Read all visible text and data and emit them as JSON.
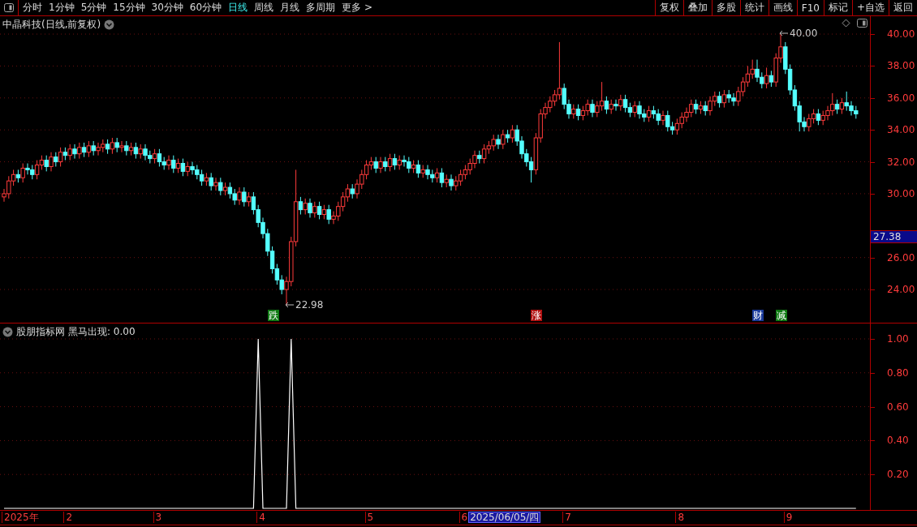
{
  "toolbar": {
    "periods": [
      {
        "label": "分时",
        "selected": false
      },
      {
        "label": "1分钟",
        "selected": false
      },
      {
        "label": "5分钟",
        "selected": false
      },
      {
        "label": "15分钟",
        "selected": false
      },
      {
        "label": "30分钟",
        "selected": false
      },
      {
        "label": "60分钟",
        "selected": false
      },
      {
        "label": "日线",
        "selected": true
      },
      {
        "label": "周线",
        "selected": false
      },
      {
        "label": "月线",
        "selected": false
      },
      {
        "label": "多周期",
        "selected": false
      },
      {
        "label": "更多 >",
        "selected": false
      }
    ],
    "buttons": [
      "复权",
      "叠加",
      "多股",
      "统计",
      "画线",
      "F10",
      "标记",
      "+自选",
      "返回"
    ]
  },
  "main_chart": {
    "title": "中晶科技(日线,前复权)",
    "current_price": "27.38",
    "price_marks": [
      "40.00",
      "22.98"
    ],
    "chart_data": {
      "type": "candlestick",
      "grid": true,
      "ylim": [
        21.92,
        41.12
      ],
      "yticks": [
        {
          "value": 40,
          "label": "40.00"
        },
        {
          "value": 38,
          "label": "38.00"
        },
        {
          "value": 36,
          "label": "36.00"
        },
        {
          "value": 34,
          "label": "34.00"
        },
        {
          "value": 32,
          "label": "32.00"
        },
        {
          "value": 30,
          "label": "30.00"
        },
        {
          "value": 26,
          "label": "26.00"
        },
        {
          "value": 24,
          "label": "24.00"
        }
      ],
      "ohlc": [
        [
          29.8,
          30.3,
          29.5,
          30.0
        ],
        [
          30.0,
          31.1,
          29.7,
          30.8
        ],
        [
          30.8,
          31.5,
          30.5,
          31.2
        ],
        [
          31.2,
          31.5,
          30.7,
          31.0
        ],
        [
          31.0,
          31.9,
          30.7,
          31.6
        ],
        [
          31.6,
          31.9,
          31.2,
          31.5
        ],
        [
          31.5,
          31.8,
          30.9,
          31.2
        ],
        [
          31.2,
          32.1,
          30.9,
          31.8
        ],
        [
          31.8,
          32.4,
          31.5,
          32.1
        ],
        [
          32.1,
          32.4,
          31.4,
          31.7
        ],
        [
          31.7,
          32.6,
          31.4,
          32.3
        ],
        [
          32.3,
          32.6,
          31.7,
          32.0
        ],
        [
          32.0,
          32.9,
          31.7,
          32.6
        ],
        [
          32.6,
          32.9,
          32.1,
          32.4
        ],
        [
          32.4,
          33.1,
          32.1,
          32.8
        ],
        [
          32.8,
          33.1,
          32.2,
          32.5
        ],
        [
          32.5,
          33.2,
          32.2,
          32.9
        ],
        [
          32.9,
          33.2,
          32.3,
          32.6
        ],
        [
          32.6,
          33.3,
          32.3,
          33.0
        ],
        [
          33.0,
          33.3,
          32.4,
          32.7
        ],
        [
          32.7,
          33.2,
          32.4,
          32.9
        ],
        [
          32.9,
          33.4,
          32.6,
          33.1
        ],
        [
          33.1,
          33.4,
          32.5,
          32.8
        ],
        [
          32.8,
          33.5,
          32.5,
          33.2
        ],
        [
          33.2,
          33.5,
          32.6,
          32.9
        ],
        [
          32.9,
          33.3,
          32.6,
          33.0
        ],
        [
          33.0,
          33.3,
          32.4,
          32.7
        ],
        [
          32.7,
          33.2,
          32.4,
          32.9
        ],
        [
          32.9,
          33.2,
          32.2,
          32.5
        ],
        [
          32.5,
          33.1,
          32.2,
          32.8
        ],
        [
          32.8,
          33.1,
          32.1,
          32.4
        ],
        [
          32.4,
          32.7,
          31.9,
          32.2
        ],
        [
          32.2,
          32.8,
          31.9,
          32.5
        ],
        [
          32.5,
          32.8,
          31.7,
          32.0
        ],
        [
          32.0,
          32.3,
          31.5,
          31.8
        ],
        [
          31.8,
          32.4,
          31.5,
          32.1
        ],
        [
          32.1,
          32.4,
          31.3,
          31.6
        ],
        [
          31.6,
          32.2,
          31.3,
          31.9
        ],
        [
          31.9,
          32.2,
          31.1,
          31.4
        ],
        [
          31.4,
          32.0,
          31.1,
          31.7
        ],
        [
          31.7,
          32.0,
          31.2,
          31.5
        ],
        [
          31.5,
          31.8,
          30.9,
          31.2
        ],
        [
          31.2,
          31.5,
          30.5,
          30.8
        ],
        [
          30.8,
          31.3,
          30.5,
          31.0
        ],
        [
          31.0,
          31.3,
          30.2,
          30.5
        ],
        [
          30.5,
          31.0,
          30.2,
          30.7
        ],
        [
          30.7,
          31.0,
          29.9,
          30.2
        ],
        [
          30.2,
          30.7,
          29.9,
          30.4
        ],
        [
          30.4,
          30.7,
          29.7,
          30.0
        ],
        [
          30.0,
          30.3,
          29.3,
          29.6
        ],
        [
          29.6,
          30.4,
          29.3,
          30.1
        ],
        [
          30.1,
          30.4,
          29.2,
          29.5
        ],
        [
          29.5,
          30.1,
          29.2,
          29.8
        ],
        [
          29.8,
          30.1,
          28.7,
          29.0
        ],
        [
          29.0,
          29.3,
          27.9,
          28.2
        ],
        [
          28.2,
          28.5,
          27.2,
          27.5
        ],
        [
          27.5,
          27.8,
          26.1,
          26.4
        ],
        [
          26.4,
          26.7,
          25.0,
          25.3
        ],
        [
          25.3,
          25.6,
          24.3,
          24.6
        ],
        [
          24.6,
          24.9,
          23.7,
          24.0
        ],
        [
          24.0,
          24.8,
          22.98,
          24.5
        ],
        [
          24.5,
          27.3,
          24.2,
          27.0
        ],
        [
          27.0,
          31.5,
          26.7,
          29.5
        ],
        [
          29.5,
          29.8,
          28.7,
          29.0
        ],
        [
          29.0,
          29.7,
          28.7,
          29.4
        ],
        [
          29.4,
          29.7,
          28.5,
          28.8
        ],
        [
          28.8,
          29.5,
          28.5,
          29.2
        ],
        [
          29.2,
          29.5,
          28.4,
          28.7
        ],
        [
          28.7,
          29.3,
          28.4,
          29.0
        ],
        [
          29.0,
          29.3,
          28.1,
          28.4
        ],
        [
          28.4,
          28.9,
          28.1,
          28.6
        ],
        [
          28.6,
          29.5,
          28.3,
          29.2
        ],
        [
          29.2,
          30.1,
          28.9,
          29.8
        ],
        [
          29.8,
          30.6,
          29.5,
          30.3
        ],
        [
          30.3,
          30.6,
          29.7,
          30.0
        ],
        [
          30.0,
          30.9,
          29.7,
          30.6
        ],
        [
          30.6,
          31.5,
          30.3,
          31.2
        ],
        [
          31.2,
          32.1,
          30.9,
          31.8
        ],
        [
          31.8,
          32.3,
          31.5,
          32.0
        ],
        [
          32.0,
          32.3,
          31.3,
          31.6
        ],
        [
          31.6,
          32.3,
          31.3,
          32.0
        ],
        [
          32.0,
          32.3,
          31.4,
          31.7
        ],
        [
          31.7,
          32.5,
          31.4,
          32.2
        ],
        [
          32.2,
          32.5,
          31.5,
          31.8
        ],
        [
          31.8,
          32.4,
          31.5,
          32.1
        ],
        [
          32.1,
          32.4,
          31.7,
          32.0
        ],
        [
          32.0,
          32.3,
          31.3,
          31.6
        ],
        [
          31.6,
          32.1,
          31.3,
          31.8
        ],
        [
          31.8,
          32.1,
          31.0,
          31.3
        ],
        [
          31.3,
          31.8,
          31.0,
          31.5
        ],
        [
          31.5,
          31.8,
          30.9,
          31.2
        ],
        [
          31.2,
          31.5,
          30.7,
          31.0
        ],
        [
          31.0,
          31.6,
          30.7,
          31.3
        ],
        [
          31.3,
          31.6,
          30.4,
          30.7
        ],
        [
          30.7,
          31.2,
          30.4,
          30.9
        ],
        [
          30.9,
          31.2,
          30.2,
          30.5
        ],
        [
          30.5,
          31.1,
          30.2,
          30.8
        ],
        [
          30.8,
          31.5,
          30.5,
          31.2
        ],
        [
          31.2,
          31.8,
          30.9,
          31.5
        ],
        [
          31.5,
          32.2,
          31.2,
          31.9
        ],
        [
          31.9,
          32.7,
          31.6,
          32.4
        ],
        [
          32.4,
          32.7,
          31.9,
          32.2
        ],
        [
          32.2,
          33.1,
          31.9,
          32.8
        ],
        [
          32.8,
          33.3,
          32.5,
          33.0
        ],
        [
          33.0,
          33.7,
          32.7,
          33.4
        ],
        [
          33.4,
          33.7,
          32.8,
          33.1
        ],
        [
          33.1,
          34.0,
          32.8,
          33.7
        ],
        [
          33.7,
          34.0,
          33.2,
          33.5
        ],
        [
          33.5,
          34.3,
          33.2,
          34.0
        ],
        [
          34.0,
          34.3,
          33.0,
          33.3
        ],
        [
          33.3,
          33.6,
          32.2,
          32.5
        ],
        [
          32.5,
          32.8,
          31.7,
          32.0
        ],
        [
          32.0,
          32.3,
          30.7,
          31.5
        ],
        [
          31.5,
          33.8,
          31.2,
          33.5
        ],
        [
          33.5,
          35.3,
          33.2,
          35.0
        ],
        [
          35.0,
          35.7,
          34.7,
          35.4
        ],
        [
          35.4,
          36.1,
          35.1,
          35.8
        ],
        [
          35.8,
          36.5,
          35.5,
          36.2
        ],
        [
          36.2,
          39.5,
          35.9,
          36.6
        ],
        [
          36.6,
          36.9,
          35.3,
          35.6
        ],
        [
          35.6,
          35.9,
          34.7,
          35.0
        ],
        [
          35.0,
          35.6,
          34.7,
          35.3
        ],
        [
          35.3,
          35.6,
          34.6,
          34.9
        ],
        [
          34.9,
          35.5,
          34.6,
          35.2
        ],
        [
          35.2,
          35.9,
          34.9,
          35.6
        ],
        [
          35.6,
          35.9,
          34.8,
          35.1
        ],
        [
          35.1,
          35.8,
          34.8,
          35.5
        ],
        [
          35.5,
          37.0,
          35.2,
          35.8
        ],
        [
          35.8,
          36.1,
          35.0,
          35.3
        ],
        [
          35.3,
          35.9,
          35.0,
          35.6
        ],
        [
          35.6,
          35.9,
          35.2,
          35.5
        ],
        [
          35.5,
          36.2,
          35.2,
          35.9
        ],
        [
          35.9,
          36.2,
          35.1,
          35.4
        ],
        [
          35.4,
          35.7,
          34.8,
          35.1
        ],
        [
          35.1,
          35.8,
          34.8,
          35.5
        ],
        [
          35.5,
          35.8,
          34.7,
          35.0
        ],
        [
          35.0,
          35.3,
          34.5,
          34.8
        ],
        [
          34.8,
          35.5,
          34.5,
          35.2
        ],
        [
          35.2,
          35.5,
          34.7,
          35.0
        ],
        [
          35.0,
          35.3,
          34.3,
          34.6
        ],
        [
          34.6,
          35.2,
          34.3,
          34.9
        ],
        [
          34.9,
          35.2,
          33.9,
          34.2
        ],
        [
          34.2,
          34.5,
          33.7,
          34.0
        ],
        [
          34.0,
          34.7,
          33.7,
          34.4
        ],
        [
          34.4,
          35.1,
          34.1,
          34.8
        ],
        [
          34.8,
          35.4,
          34.5,
          35.1
        ],
        [
          35.1,
          35.9,
          34.8,
          35.6
        ],
        [
          35.6,
          35.9,
          35.0,
          35.3
        ],
        [
          35.3,
          35.8,
          35.0,
          35.5
        ],
        [
          35.5,
          35.8,
          34.9,
          35.2
        ],
        [
          35.2,
          36.1,
          34.9,
          35.8
        ],
        [
          35.8,
          36.4,
          35.5,
          36.1
        ],
        [
          36.1,
          36.4,
          35.4,
          35.7
        ],
        [
          35.7,
          36.5,
          35.4,
          36.2
        ],
        [
          36.2,
          36.5,
          35.7,
          36.0
        ],
        [
          36.0,
          36.3,
          35.5,
          35.8
        ],
        [
          35.8,
          36.7,
          35.5,
          36.4
        ],
        [
          36.4,
          37.3,
          36.1,
          37.0
        ],
        [
          37.0,
          38.0,
          36.7,
          37.5
        ],
        [
          37.5,
          38.4,
          37.2,
          37.8
        ],
        [
          37.8,
          38.4,
          37.0,
          37.3
        ],
        [
          37.3,
          37.6,
          36.6,
          36.9
        ],
        [
          36.9,
          37.9,
          36.6,
          37.4
        ],
        [
          37.4,
          37.7,
          36.7,
          37.0
        ],
        [
          37.0,
          38.8,
          36.7,
          38.5
        ],
        [
          38.5,
          40.0,
          38.2,
          39.2
        ],
        [
          39.2,
          39.5,
          37.5,
          37.8
        ],
        [
          37.8,
          38.1,
          36.2,
          36.5
        ],
        [
          36.5,
          36.8,
          35.2,
          35.5
        ],
        [
          35.5,
          35.8,
          33.9,
          34.5
        ],
        [
          34.5,
          34.8,
          33.9,
          34.2
        ],
        [
          34.2,
          35.0,
          33.9,
          34.7
        ],
        [
          34.7,
          35.3,
          34.4,
          35.0
        ],
        [
          35.0,
          35.3,
          34.3,
          34.6
        ],
        [
          34.6,
          35.2,
          34.3,
          34.9
        ],
        [
          34.9,
          35.5,
          34.6,
          35.2
        ],
        [
          35.2,
          36.3,
          34.9,
          35.6
        ],
        [
          35.6,
          35.9,
          35.0,
          35.3
        ],
        [
          35.3,
          36.0,
          35.0,
          35.7
        ],
        [
          35.7,
          36.4,
          35.2,
          35.5
        ],
        [
          35.5,
          35.8,
          34.9,
          35.2
        ],
        [
          35.2,
          35.5,
          34.7,
          35.0
        ]
      ]
    },
    "events": [
      {
        "label": "跌",
        "color": "#0e7a12"
      },
      {
        "label": "涨",
        "color": "#b01010"
      },
      {
        "label": "财",
        "color": "#1a3a9a"
      },
      {
        "label": "减",
        "color": "#0e7a12"
      }
    ]
  },
  "indicator": {
    "title": "股朋指标网",
    "reading": "黑马出现: 0.00",
    "chart_data": {
      "type": "line",
      "grid": true,
      "ylim": [
        0,
        1
      ],
      "yticks": [
        {
          "value": 1,
          "label": "1.00"
        },
        {
          "value": 0.8,
          "label": "0.80"
        },
        {
          "value": 0.6,
          "label": "0.60"
        },
        {
          "value": 0.4,
          "label": "0.40"
        },
        {
          "value": 0.2,
          "label": "0.20"
        }
      ],
      "series": [
        {
          "color": "#ffffff",
          "values": [
            0,
            0,
            0,
            0,
            0,
            0,
            0,
            0,
            0,
            0,
            0,
            0,
            0,
            0,
            0,
            0,
            0,
            0,
            0,
            0,
            0,
            0,
            0,
            0,
            0,
            0,
            0,
            0,
            0,
            0,
            0,
            0,
            0,
            0,
            0,
            0,
            0,
            0,
            0,
            0,
            0,
            0,
            0,
            0,
            0,
            0,
            0,
            0,
            0,
            0,
            0,
            0,
            0,
            0,
            1,
            0,
            0,
            0,
            0,
            0,
            0,
            1,
            0,
            0,
            0,
            0,
            0,
            0,
            0,
            0,
            0,
            0,
            0,
            0,
            0,
            0,
            0,
            0,
            0,
            0,
            0,
            0,
            0,
            0,
            0,
            0,
            0,
            0,
            0,
            0,
            0,
            0,
            0,
            0,
            0,
            0,
            0,
            0,
            0,
            0,
            0,
            0,
            0,
            0,
            0,
            0,
            0,
            0,
            0,
            0,
            0,
            0,
            0,
            0,
            0,
            0,
            0,
            0,
            0,
            0,
            0,
            0,
            0,
            0,
            0,
            0,
            0,
            0,
            0,
            0,
            0,
            0,
            0,
            0,
            0,
            0,
            0,
            0,
            0,
            0,
            0,
            0,
            0,
            0,
            0,
            0,
            0,
            0,
            0,
            0,
            0,
            0,
            0,
            0,
            0,
            0,
            0,
            0,
            0,
            0,
            0,
            0,
            0,
            0,
            0,
            0,
            0,
            0,
            0,
            0,
            0,
            0,
            0,
            0,
            0,
            0,
            0,
            0,
            0,
            0,
            0,
            0
          ]
        }
      ]
    }
  },
  "time_axis": {
    "labels": [
      "2025年",
      "2",
      "3",
      "4",
      "5",
      "6",
      "7",
      "8",
      "9"
    ],
    "cursor_date": "2025/06/05/四"
  }
}
